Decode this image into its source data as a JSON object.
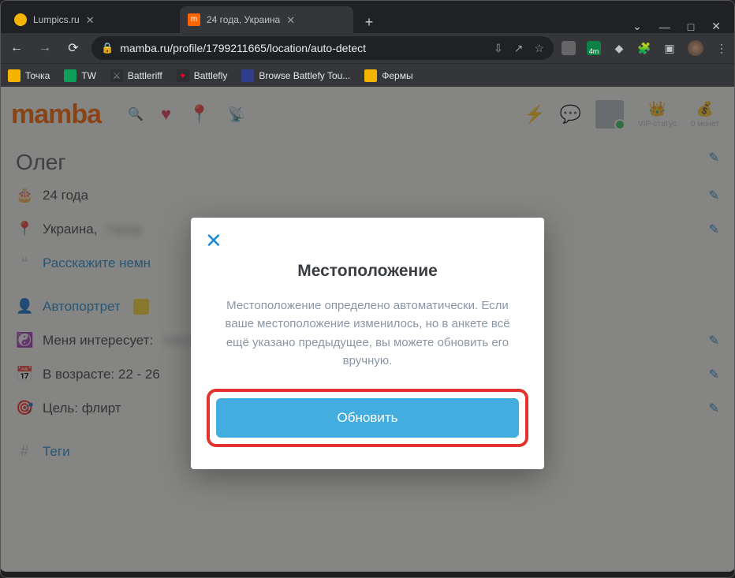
{
  "browser": {
    "tabs": [
      {
        "title": "Lumpics.ru",
        "favicon_color": "#f4b400"
      },
      {
        "title": "24 года, Украина",
        "favicon_color": "#ff6600"
      }
    ],
    "url_display": "mamba.ru/profile/1799211665/location/auto-detect",
    "bookmarks": [
      {
        "label": "Точка",
        "style": "sq-y"
      },
      {
        "label": "TW",
        "style": "sq-g"
      },
      {
        "label": "Battleriff",
        "style": "sq-d"
      },
      {
        "label": "Battlefly",
        "style": "sq-r"
      },
      {
        "label": "Browse Battlefy Tou...",
        "style": "sq-bl"
      },
      {
        "label": "Фермы",
        "style": "sq-y"
      }
    ]
  },
  "page": {
    "logo": "mamba",
    "header_right": {
      "vip_label": "VIP-статус",
      "coins_label": "0 монет"
    },
    "profile": {
      "name": "Олег",
      "age": "24 года",
      "location": "Украина,",
      "about_prompt": "Расскажите немн",
      "selfportrait_label": "Автопортрет",
      "interest_label": "Меня интересует:",
      "age_range_label": "В возрасте: 22 - 26",
      "goal_label": "Цель: флирт",
      "tags_label": "Теги"
    }
  },
  "modal": {
    "title": "Местоположение",
    "text": "Местоположение определено автоматически. Если ваше местоположение изменилось, но в анкете всё ещё указано предыдущее, вы можете обновить его вручную.",
    "button_label": "Обновить"
  }
}
